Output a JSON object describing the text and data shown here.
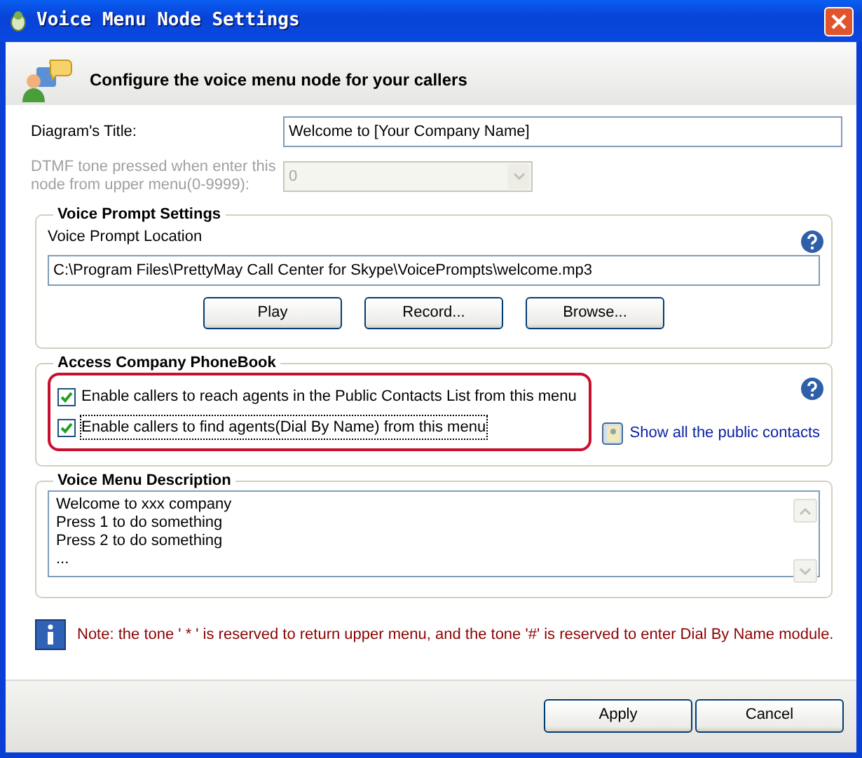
{
  "window": {
    "title": "Voice Menu Node Settings"
  },
  "header": {
    "text": "Configure the voice menu node for your callers"
  },
  "fields": [
    {
      "kind": "text",
      "label": "Diagram's Title:",
      "value": "Welcome to [Your Company Name]",
      "disabled": false
    },
    {
      "kind": "select",
      "label": "DTMF tone pressed when enter this node from upper menu(0-9999):",
      "value": "0",
      "disabled": true
    }
  ],
  "voice_prompt": {
    "title": "Voice Prompt Settings",
    "location_label": "Voice Prompt Location",
    "location": "C:\\Program Files\\PrettyMay Call Center for Skype\\VoicePrompts\\welcome.mp3",
    "buttons": [
      "Play",
      "Record...",
      "Browse..."
    ]
  },
  "phonebook": {
    "title": "Access Company PhoneBook",
    "options": [
      {
        "label": "Enable callers to reach agents in the Public Contacts List from this menu",
        "checked": true,
        "focused": false
      },
      {
        "label": "Enable callers to find agents(Dial By Name) from this menu",
        "checked": true,
        "focused": true
      }
    ],
    "link": "Show all the public contacts"
  },
  "description": {
    "title": "Voice Menu Description",
    "text": "Welcome to xxx company\nPress 1 to do something\nPress 2 to do something\n..."
  },
  "note": "Note: the tone ' * ' is reserved to return upper menu, and the tone '#' is reserved to enter Dial By Name module.",
  "buttons": [
    "Apply",
    "Cancel"
  ]
}
